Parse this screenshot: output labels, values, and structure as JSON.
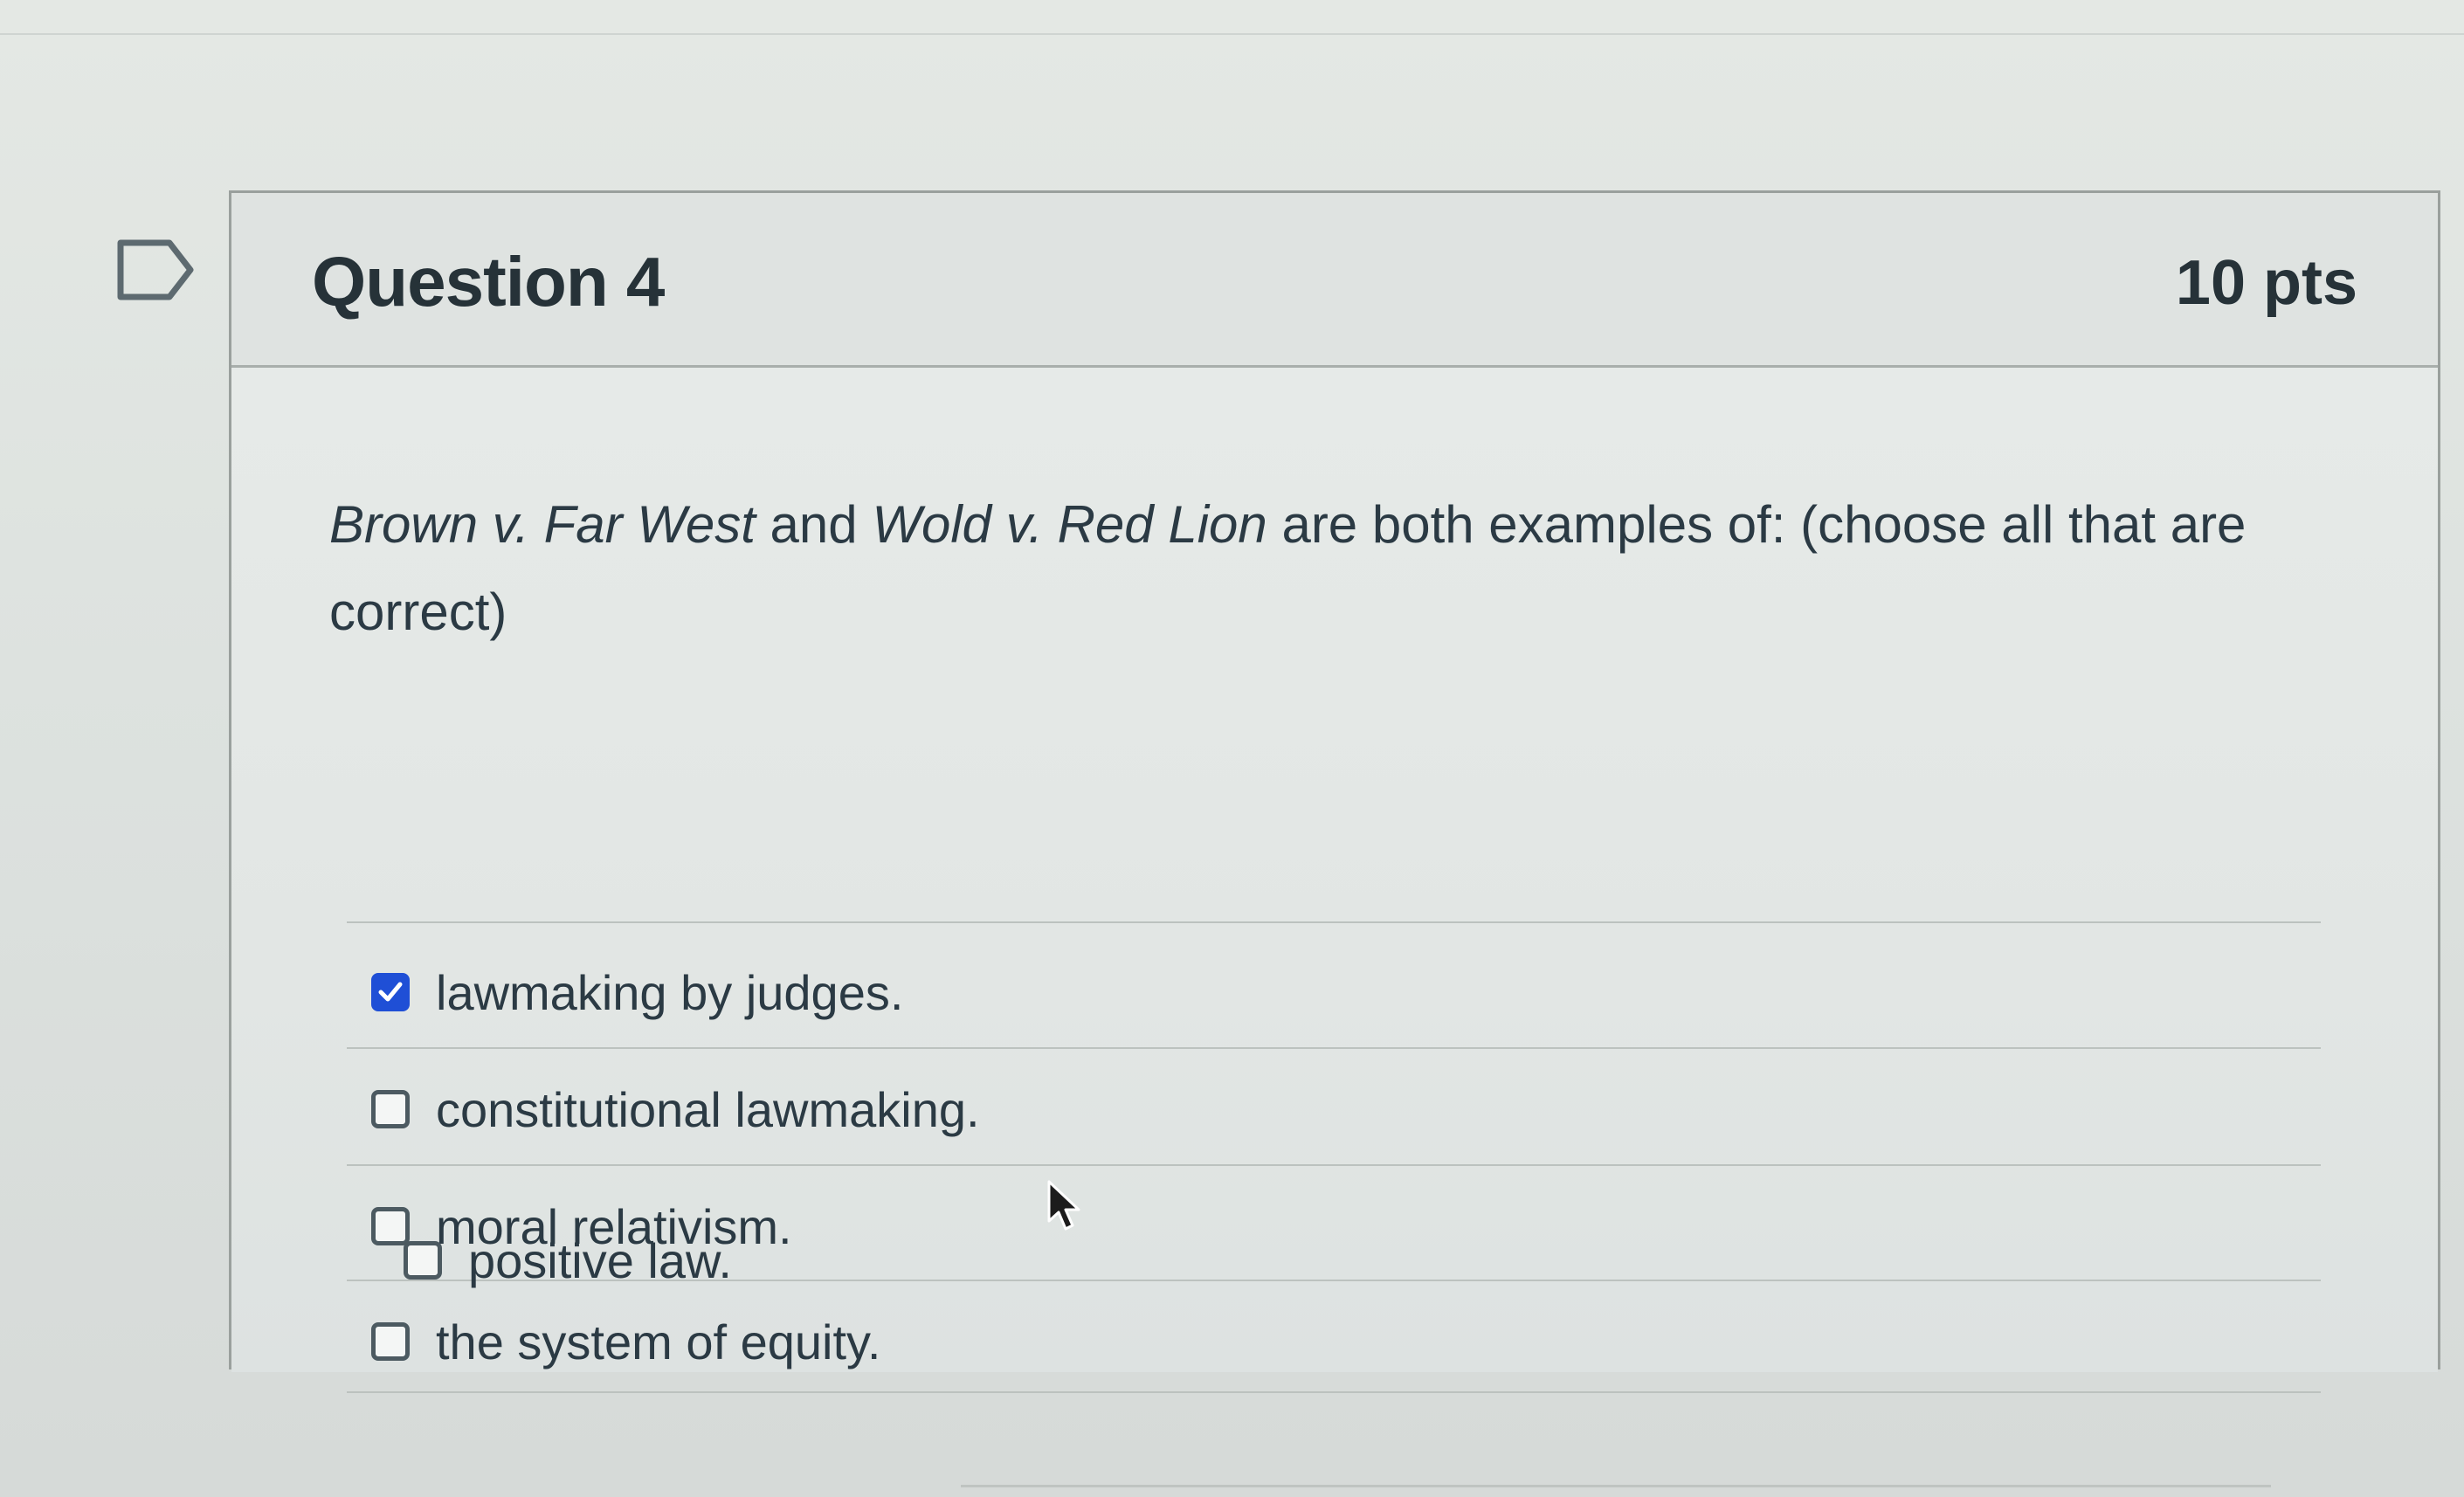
{
  "question": {
    "title": "Question 4",
    "points": "10 pts",
    "text_parts": [
      {
        "text": "Brown v. Far West",
        "italic": true
      },
      {
        "text": " and ",
        "italic": false
      },
      {
        "text": "Wold v. Red Lion",
        "italic": true
      },
      {
        "text": " are both examples of: (choose all that are correct)",
        "italic": false
      }
    ],
    "answers": [
      {
        "label": "lawmaking by judges.",
        "checked": true
      },
      {
        "label": "constitutional lawmaking.",
        "checked": false
      },
      {
        "label": "moral relativism.",
        "checked": false
      },
      {
        "label": "the system of equity.",
        "checked": false
      },
      {
        "label": "positive law.",
        "checked": false
      }
    ]
  },
  "icons": {
    "bookmark": "bookmark-flag-icon",
    "checkmark": "checkmark-icon",
    "cursor": "mouse-pointer-icon"
  },
  "colors": {
    "checked": "#1f4fd6",
    "text": "#2b3a44",
    "border": "#9aa09d"
  }
}
